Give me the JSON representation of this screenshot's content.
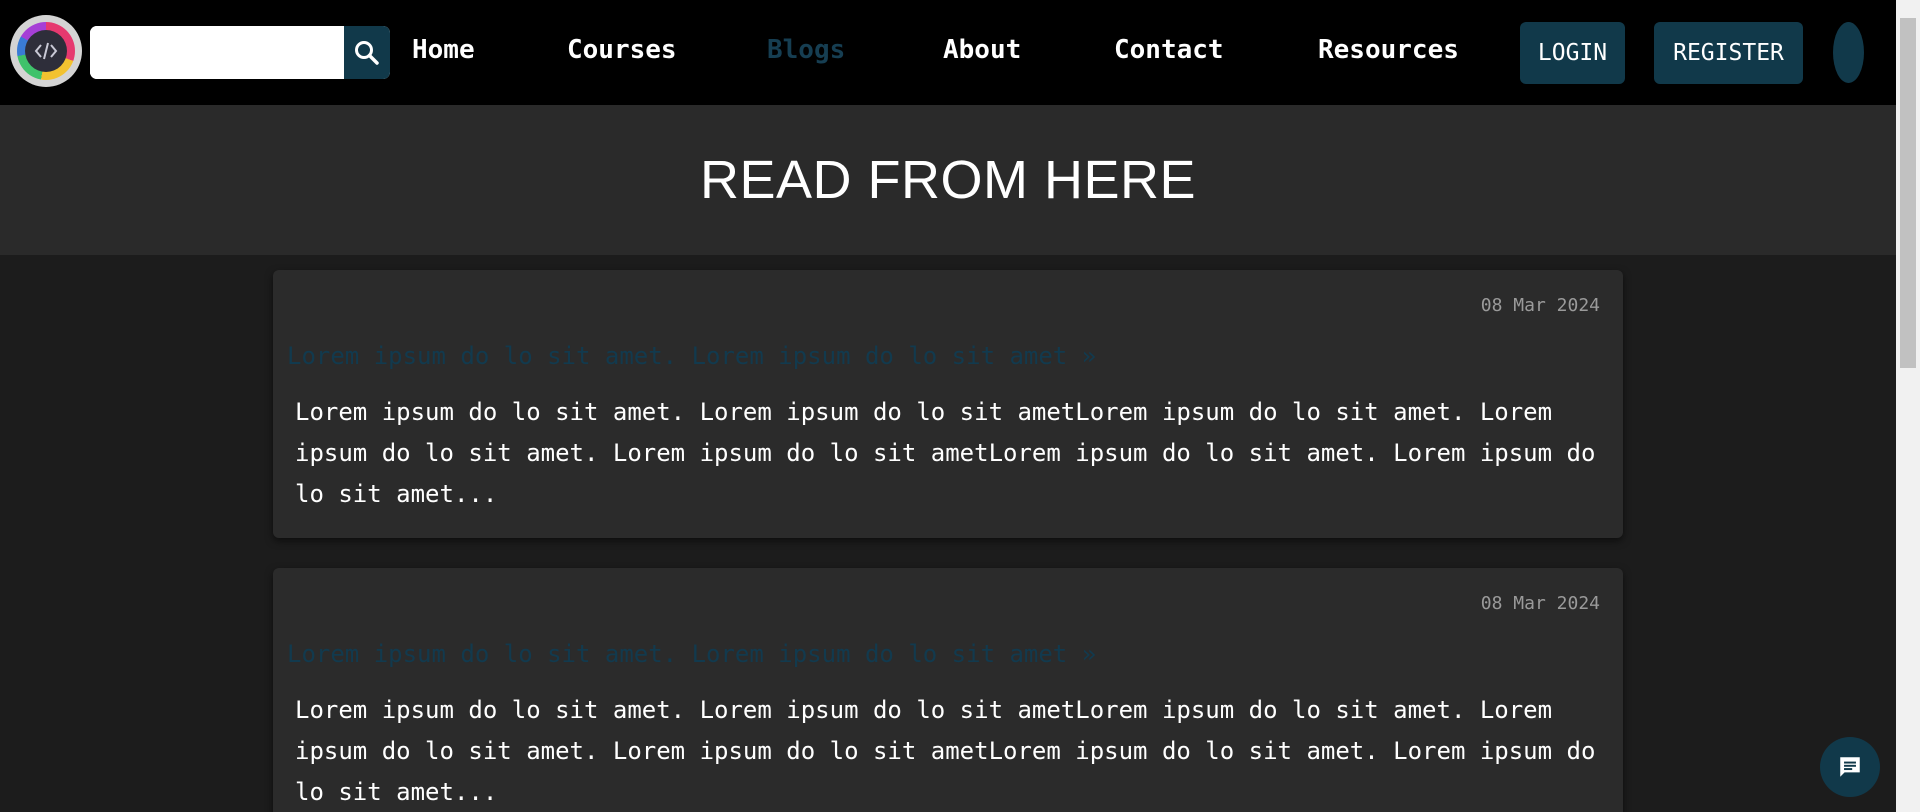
{
  "header": {
    "search": {
      "value": "",
      "placeholder": ""
    },
    "nav": [
      {
        "label": "Home"
      },
      {
        "label": "Courses"
      },
      {
        "label": "Blogs",
        "active": true
      },
      {
        "label": "About"
      },
      {
        "label": "Contact"
      },
      {
        "label": "Resources"
      }
    ],
    "login_label": "LOGIN",
    "register_label": "REGISTER"
  },
  "hero": {
    "title": "READ FROM HERE"
  },
  "posts": [
    {
      "date": "08 Mar 2024",
      "title": "Lorem ipsum do lo sit amet. Lorem ipsum do lo sit amet »",
      "excerpt": "Lorem ipsum do lo sit amet. Lorem ipsum do lo sit ametLorem ipsum do lo sit amet. Lorem ipsum do lo sit amet. Lorem ipsum do lo sit ametLorem ipsum do lo sit amet. Lorem ipsum do lo sit amet..."
    },
    {
      "date": "08 Mar 2024",
      "title": "Lorem ipsum do lo sit amet. Lorem ipsum do lo sit amet »",
      "excerpt": "Lorem ipsum do lo sit amet. Lorem ipsum do lo sit ametLorem ipsum do lo sit amet. Lorem ipsum do lo sit amet. Lorem ipsum do lo sit ametLorem ipsum do lo sit amet. Lorem ipsum do lo sit amet..."
    }
  ],
  "icons": {
    "logo": "code-logo-icon",
    "search": "search-icon",
    "chat": "chat-icon"
  },
  "colors": {
    "accent": "#11394a",
    "active_link": "#163e52",
    "page_bg": "#1c1c1c",
    "hero_bg": "#2a2a2a",
    "card_bg": "#2b2b2b",
    "navbar_bg": "#000000"
  }
}
